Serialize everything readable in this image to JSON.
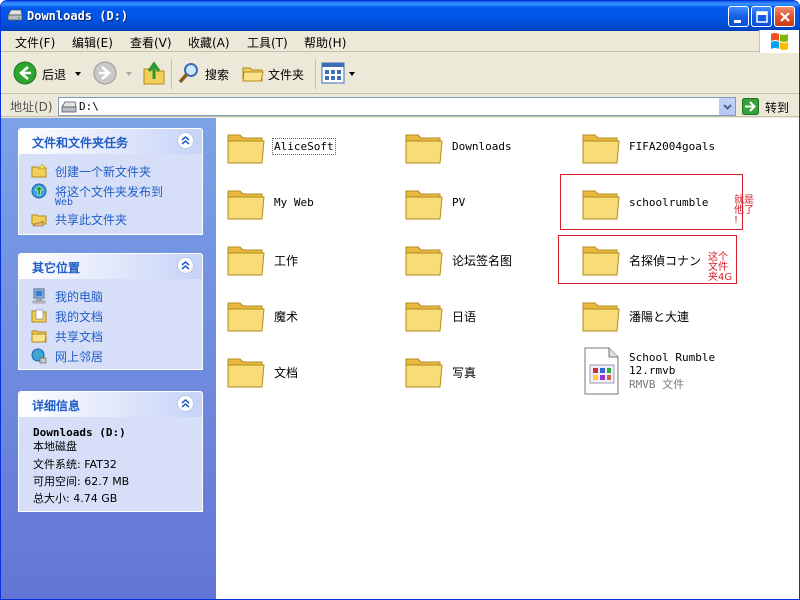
{
  "window": {
    "title": "Downloads (D:)"
  },
  "menu": [
    "文件(F)",
    "编辑(E)",
    "查看(V)",
    "收藏(A)",
    "工具(T)",
    "帮助(H)"
  ],
  "toolbar": {
    "back_label": "后退",
    "search_label": "搜索",
    "folders_label": "文件夹"
  },
  "address": {
    "label": "地址(D)",
    "value": "D:\\",
    "go_label": "转到"
  },
  "panels": {
    "tasks": {
      "title": "文件和文件夹任务",
      "items": [
        "创建一个新文件夹",
        "将这个文件夹发布到",
        "Web",
        "共享此文件夹"
      ]
    },
    "places": {
      "title": "其它位置",
      "items": [
        "我的电脑",
        "我的文档",
        "共享文档",
        "网上邻居"
      ]
    },
    "details": {
      "title": "详细信息",
      "name": "Downloads (D:)",
      "type": "本地磁盘",
      "fs": "文件系统: FAT32",
      "free": "可用空间: 62.7 MB",
      "total": "总大小: 4.74 GB"
    }
  },
  "files": [
    {
      "name": "AliceSoft",
      "kind": "folder"
    },
    {
      "name": "Downloads",
      "kind": "folder"
    },
    {
      "name": "FIFA2004goals",
      "kind": "folder"
    },
    {
      "name": "My Web",
      "kind": "folder"
    },
    {
      "name": "PV",
      "kind": "folder"
    },
    {
      "name": "schoolrumble",
      "kind": "folder"
    },
    {
      "name": "工作",
      "kind": "folder"
    },
    {
      "name": "论坛签名图",
      "kind": "folder"
    },
    {
      "name": "名探偵コナン",
      "kind": "folder"
    },
    {
      "name": "魔术",
      "kind": "folder"
    },
    {
      "name": "日语",
      "kind": "folder"
    },
    {
      "name": "潘陽と大連",
      "kind": "folder"
    },
    {
      "name": "文档",
      "kind": "folder"
    },
    {
      "name": "写真",
      "kind": "folder"
    },
    {
      "name": "School Rumble",
      "name2": "12.rmvb",
      "type": "RMVB 文件",
      "kind": "rmvb-file"
    }
  ],
  "annotations": {
    "a1": "就是\n他了\n!",
    "a2": "这个\n文件\n夹4G"
  },
  "colors": {
    "title_bar": "#0054e3",
    "link_blue": "#215dc6",
    "panel_bg": "#d6dff7",
    "annotation_red": "#d9202a",
    "folder_yellow": "#f6d364"
  }
}
